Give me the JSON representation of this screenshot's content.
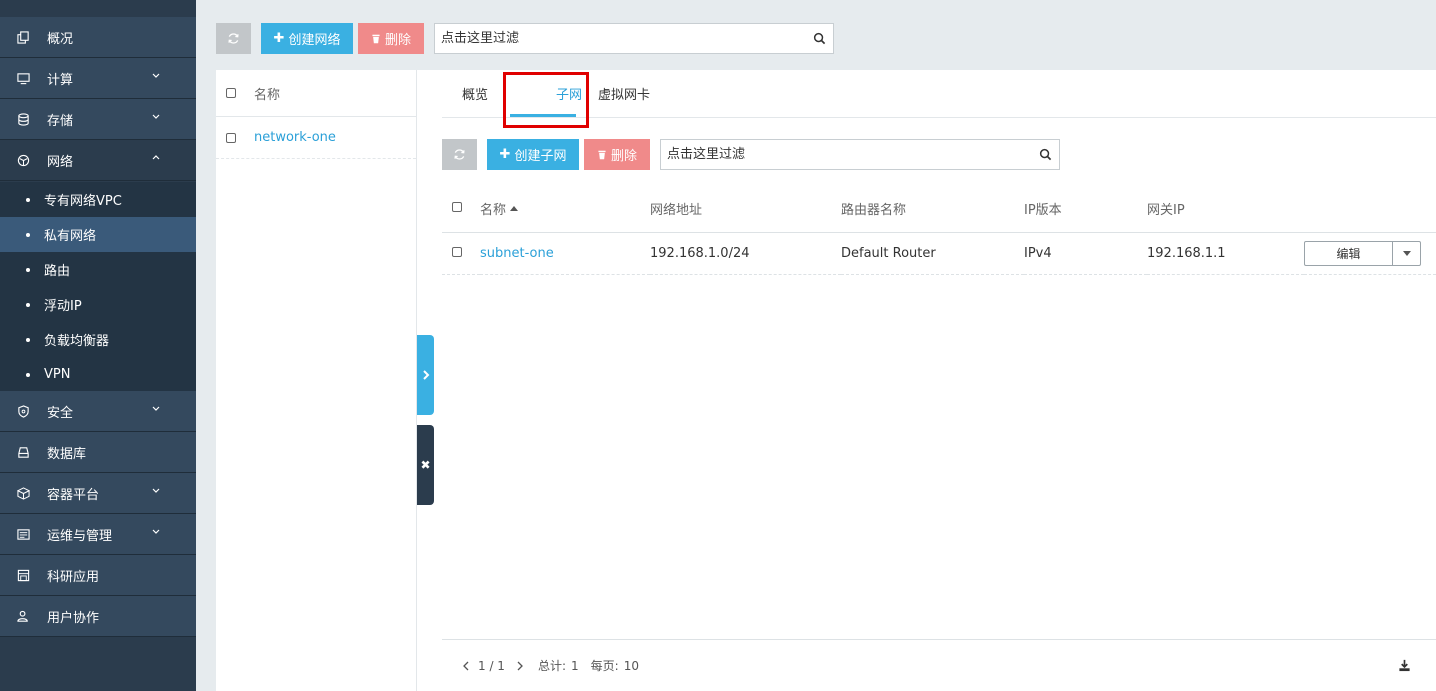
{
  "sidebar": {
    "items": [
      {
        "label": "概况",
        "icon": "copy-icon",
        "expandable": false
      },
      {
        "label": "计算",
        "icon": "monitor-icon",
        "expandable": true
      },
      {
        "label": "存储",
        "icon": "database-icon",
        "expandable": true
      },
      {
        "label": "网络",
        "icon": "network-icon",
        "expandable": true,
        "open": true
      },
      {
        "label": "安全",
        "icon": "shield-icon",
        "expandable": true
      },
      {
        "label": "数据库",
        "icon": "server-icon",
        "expandable": false
      },
      {
        "label": "容器平台",
        "icon": "cubes-icon",
        "expandable": true
      },
      {
        "label": "运维与管理",
        "icon": "console-icon",
        "expandable": true
      },
      {
        "label": "科研应用",
        "icon": "lab-icon",
        "expandable": false
      },
      {
        "label": "用户协作",
        "icon": "users-icon",
        "expandable": false
      }
    ],
    "network_children": [
      "专有网络VPC",
      "私有网络",
      "路由",
      "浮动IP",
      "负载均衡器",
      "VPN"
    ],
    "active_child": "私有网络"
  },
  "toolbar": {
    "create_label": "创建网络",
    "delete_label": "删除",
    "search_placeholder": "点击这里过滤"
  },
  "network_list": {
    "header": "名称",
    "rows": [
      "network-one"
    ]
  },
  "detail": {
    "tabs": [
      "概览",
      "子网",
      "虚拟网卡"
    ],
    "active_tab": "子网",
    "toolbar": {
      "create_label": "创建子网",
      "delete_label": "删除",
      "search_placeholder": "点击这里过滤"
    },
    "table": {
      "columns": [
        "名称",
        "网络地址",
        "路由器名称",
        "IP版本",
        "网关IP"
      ],
      "rows": [
        {
          "name": "subnet-one",
          "cidr": "192.168.1.0/24",
          "router": "Default Router",
          "ip_version": "IPv4",
          "gateway": "192.168.1.1",
          "action": "编辑"
        }
      ]
    },
    "pagination": {
      "page": "1 / 1",
      "total_label": "总计:",
      "total": "1",
      "per_page_label": "每页:",
      "per_page": "10"
    }
  },
  "colors": {
    "sidebar_bg": "#34495e",
    "primary": "#3ab0e2",
    "danger": "#f08a8a",
    "link": "#2ba0d8",
    "highlight": "#e00000"
  }
}
